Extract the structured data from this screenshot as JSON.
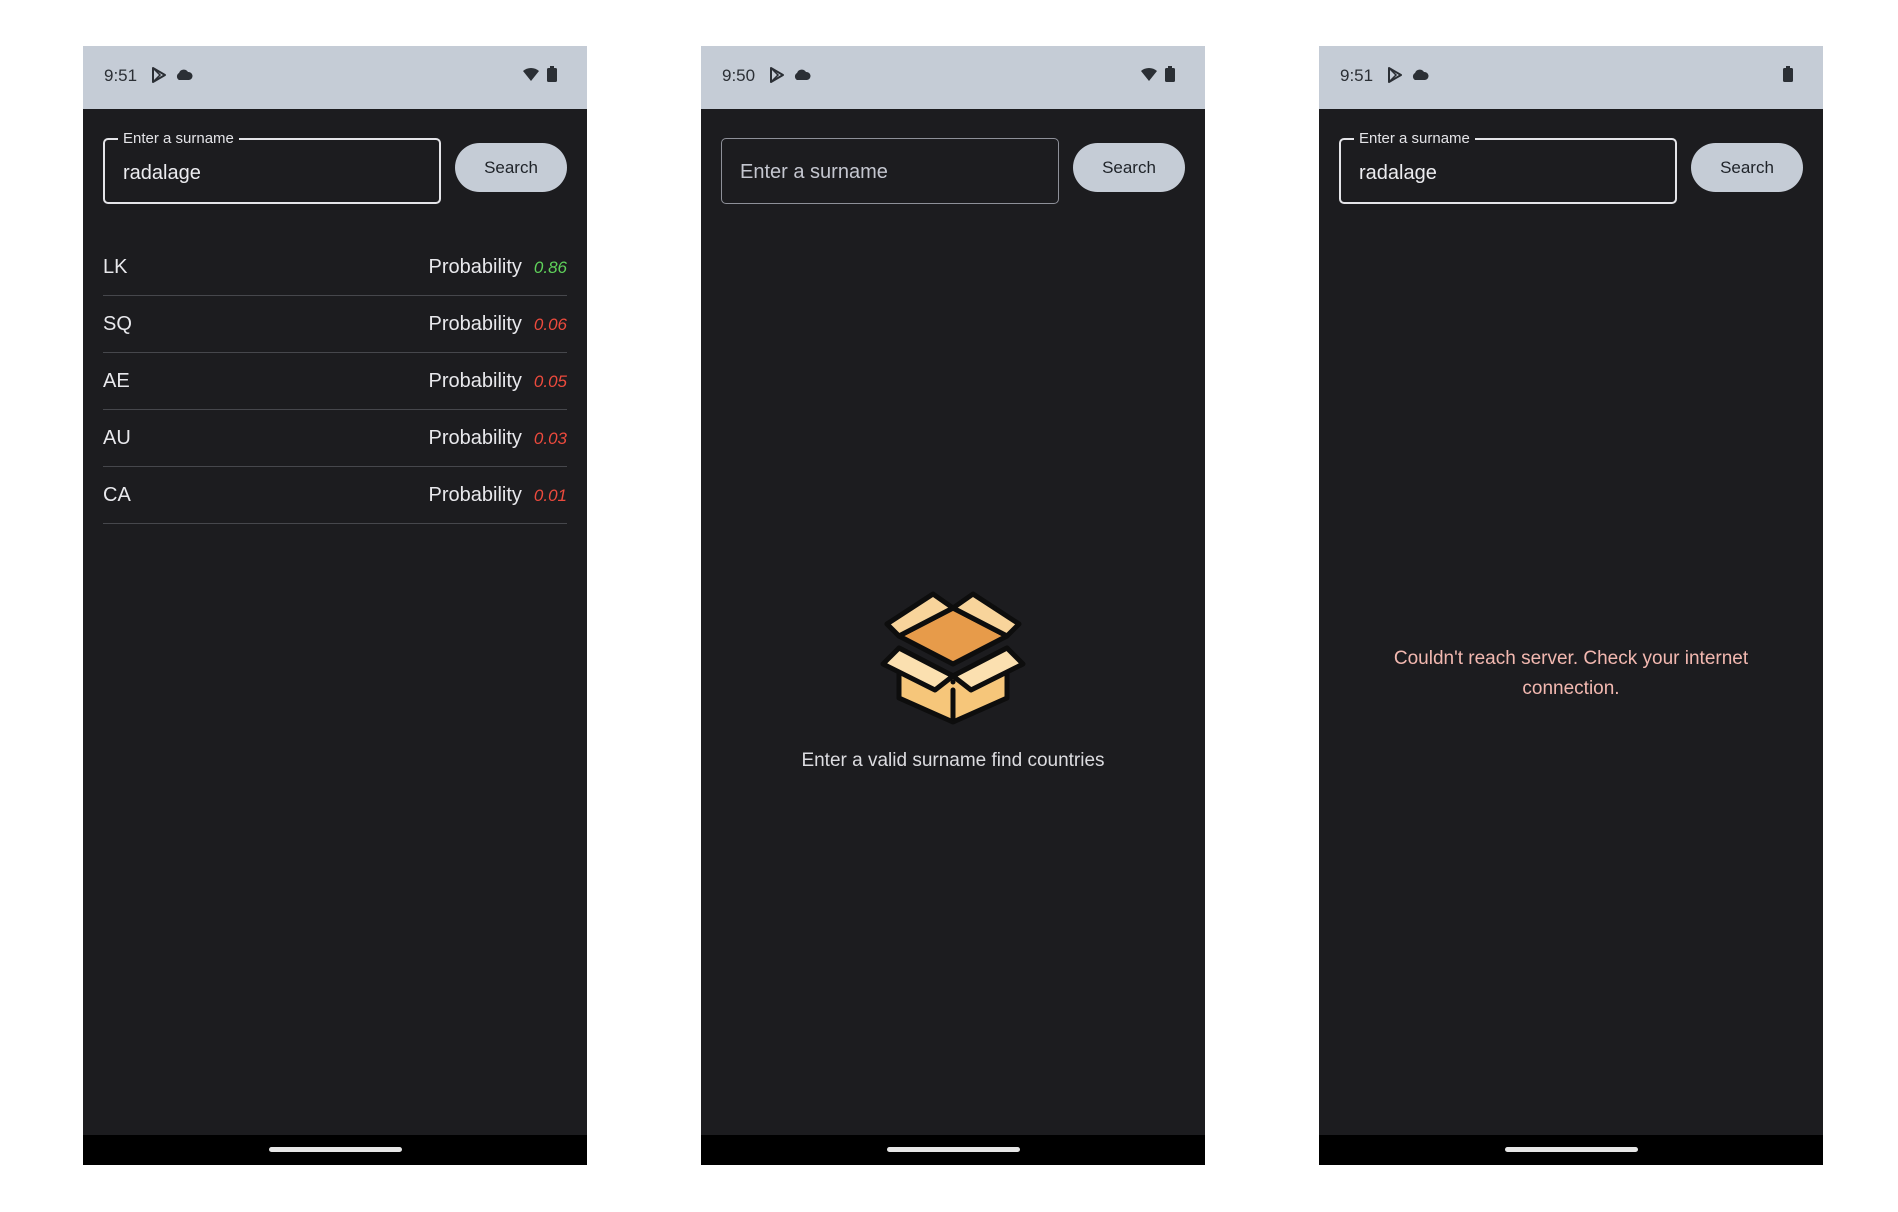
{
  "screens": [
    {
      "status": {
        "time": "9:51"
      },
      "search": {
        "label": "Enter a surname",
        "value": "radalage",
        "button_label": "Search"
      },
      "results": [
        {
          "code": "LK",
          "label": "Probability",
          "value": "0.86",
          "color": "#5fd15a"
        },
        {
          "code": "SQ",
          "label": "Probability",
          "value": "0.06",
          "color": "#ec4a3d"
        },
        {
          "code": "AE",
          "label": "Probability",
          "value": "0.05",
          "color": "#ec4a3d"
        },
        {
          "code": "AU",
          "label": "Probability",
          "value": "0.03",
          "color": "#ec4a3d"
        },
        {
          "code": "CA",
          "label": "Probability",
          "value": "0.01",
          "color": "#ec4a3d"
        }
      ]
    },
    {
      "status": {
        "time": "9:50"
      },
      "search": {
        "placeholder": "Enter a surname",
        "button_label": "Search"
      },
      "empty_state": {
        "icon": "open-box-icon",
        "message": "Enter a valid surname find countries"
      }
    },
    {
      "status": {
        "time": "9:51"
      },
      "search": {
        "label": "Enter a surname",
        "value": "radalage",
        "button_label": "Search"
      },
      "error": {
        "message": "Couldn't reach server. Check your internet connection.",
        "color": "#f2b8b0"
      }
    }
  ],
  "colors": {
    "background": "#1c1c1f",
    "status_bar": "#c5ccd6",
    "button": "#c5ccd6",
    "positive": "#5fd15a",
    "negative": "#ec4a3d"
  }
}
